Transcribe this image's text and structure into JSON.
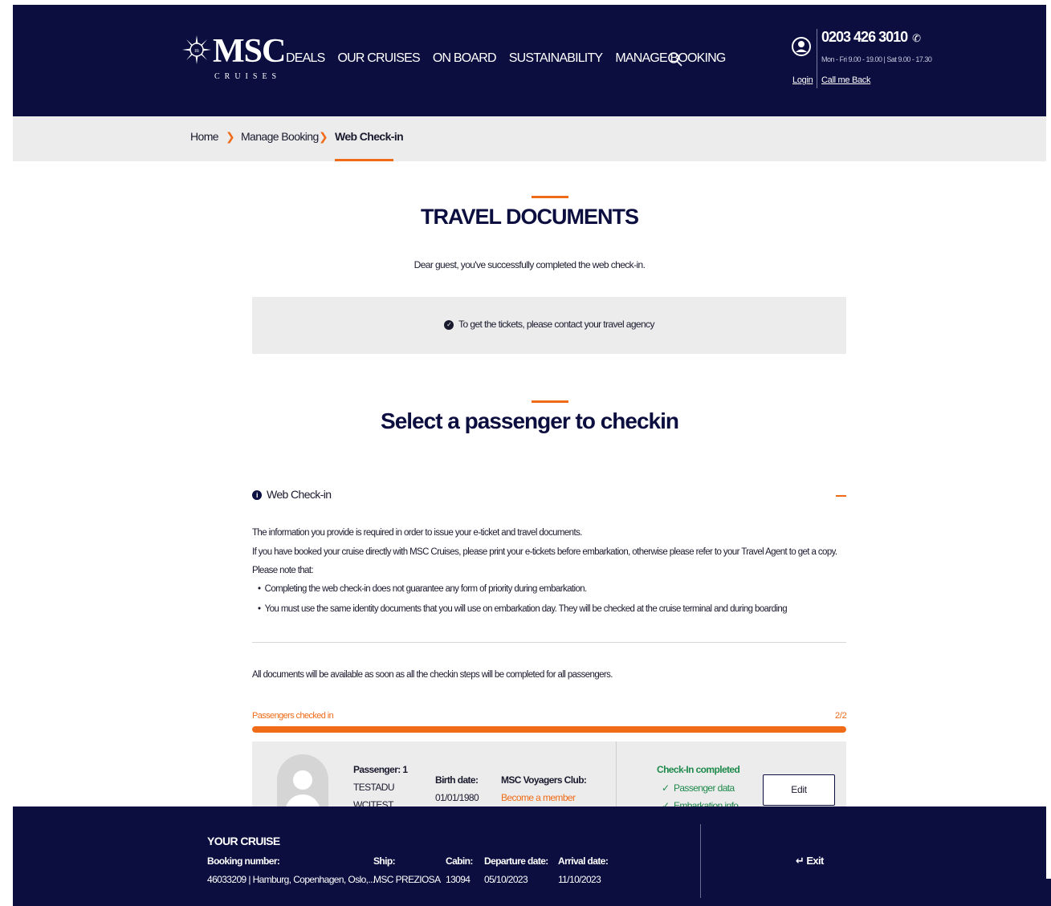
{
  "header": {
    "brand": "MSC",
    "brand_sub": "CRUISES",
    "nav": [
      "DEALS",
      "OUR CRUISES",
      "ON BOARD",
      "SUSTAINABILITY",
      "MANAGE BOOKING"
    ],
    "phone": "0203 426 3010",
    "hours": "Mon - Fri 9.00 - 19.00 | Sat 9.00 - 17.30",
    "login": "Login",
    "callback": "Call me Back"
  },
  "breadcrumb": {
    "home": "Home",
    "manage": "Manage Booking",
    "current": "Web Check-in"
  },
  "travel_docs": {
    "title": "TRAVEL DOCUMENTS",
    "subtitle": "Dear guest, you've successfully completed the web check-in.",
    "notice": "To get the tickets, please contact your travel agency"
  },
  "select": {
    "title": "Select a passenger to checkin"
  },
  "webcheckin": {
    "heading": "Web Check-in",
    "p1": "The information you provide is required in order to issue your e-ticket and travel documents.",
    "p2": "If you have booked your cruise directly with MSC Cruises, please print your e-tickets before embarkation, otherwise please refer to your Travel Agent to get a copy.",
    "p3": "Please note that:",
    "bullets": [
      "Completing the web check-in does not guarantee any form of priority during embarkation.",
      "You must use the same identity documents that you will use on embarkation day. They will be checked at the cruise terminal and during boarding"
    ],
    "availability": "All documents will be available as soon as all the checkin steps will be completed for all passengers."
  },
  "progress": {
    "label": "Passengers checked in",
    "count": "2/2",
    "fraction": 1.0
  },
  "passenger": {
    "label": "Passenger: 1",
    "first": "TESTADU",
    "last": "WCITEST",
    "birth_label": "Birth date:",
    "birth": "01/01/1980",
    "club_label": "MSC Voyagers Club:",
    "club_link": "Become a member",
    "status_title": "Check-In completed",
    "status_items": [
      "Passenger data",
      "Embarkation info"
    ],
    "edit": "Edit"
  },
  "footer": {
    "title": "YOUR CRUISE",
    "booking_label": "Booking number:",
    "booking": "46033209 | Hamburg, Copenhagen, Oslo,...",
    "ship_label": "Ship:",
    "ship": "MSC PREZIOSA",
    "cabin_label": "Cabin:",
    "cabin": "13094",
    "departure_label": "Departure date:",
    "departure": "05/10/2023",
    "arrival_label": "Arrival date:",
    "arrival": "11/10/2023",
    "exit": "Exit"
  },
  "colors": {
    "navy": "#0b0e3f",
    "accent": "#f06b18",
    "success": "#1f8a4c"
  }
}
